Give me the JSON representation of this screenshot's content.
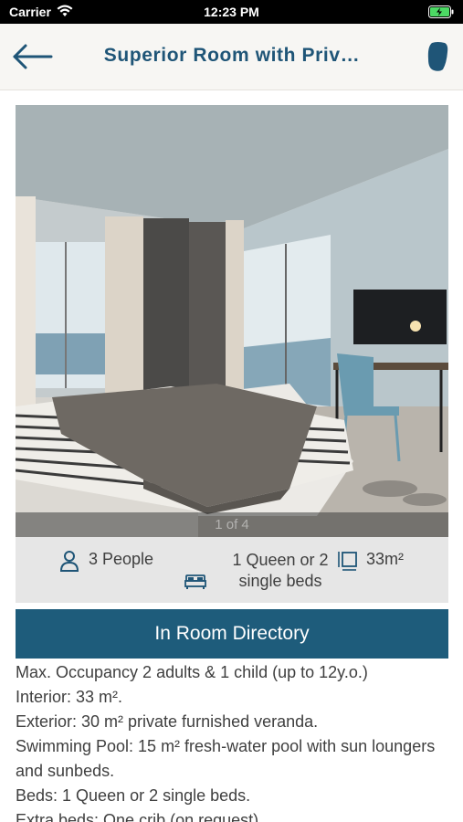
{
  "status_bar": {
    "carrier": "Carrier",
    "time": "12:23 PM"
  },
  "nav": {
    "title": "Superior Room with Priv…",
    "back_icon": "arrow-left-icon",
    "action_icon": "shape-icon"
  },
  "gallery": {
    "page_indicator": "1 of 4"
  },
  "features": {
    "people": "3 People",
    "beds": "1 Queen or 2 single beds",
    "area": "33m²"
  },
  "directory_button": {
    "label": "In Room Directory"
  },
  "description": {
    "lines": [
      " Max. Occupancy 2 adults & 1 child (up to 12y.o.)",
      "Interior: 33 m².",
      "Exterior: 30 m² private furnished veranda.",
      "Swimming Pool: 15 m² fresh-water pool with sun loungers and sunbeds.",
      "Beds: 1 Queen or 2 single beds.",
      "Extra beds: One crib (on request)"
    ]
  },
  "colors": {
    "accent": "#1e5c7b",
    "title": "#1f5577",
    "feature_bg": "#e6e6e6"
  }
}
